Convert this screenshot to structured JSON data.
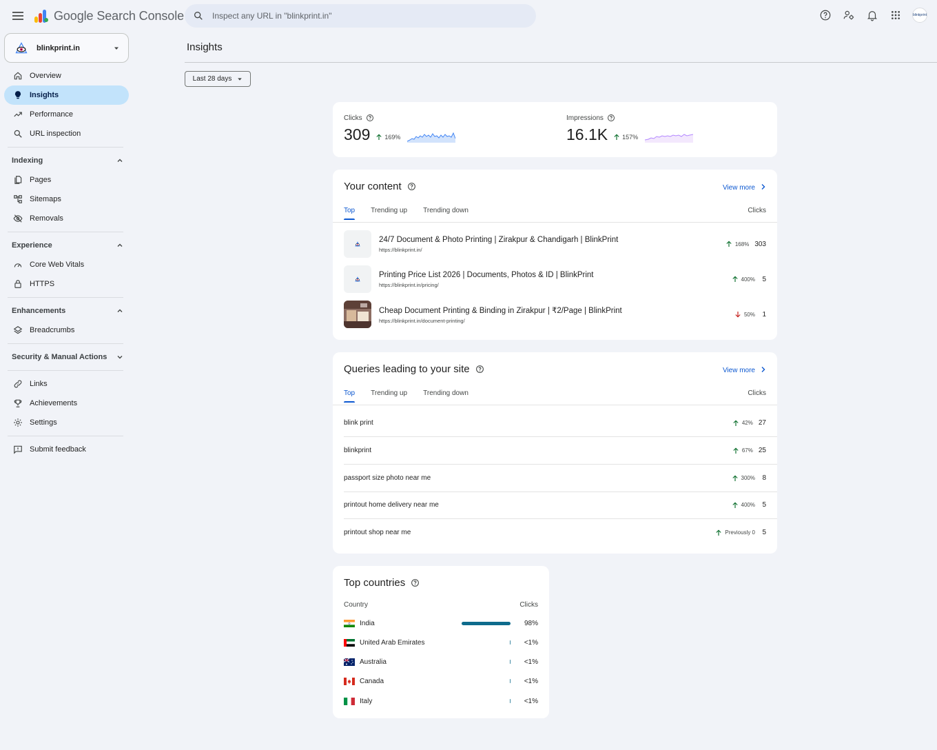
{
  "app": {
    "title": "Google Search Console",
    "search_placeholder": "Inspect any URL in \"blinkprint.in\"",
    "avatar_text": "blinkprint"
  },
  "property": {
    "name": "blinkprint.in"
  },
  "sidebar": {
    "top_items": [
      {
        "label": "Overview",
        "icon": "home-icon"
      },
      {
        "label": "Insights",
        "icon": "lightbulb-icon",
        "active": true
      },
      {
        "label": "Performance",
        "icon": "trending-icon"
      },
      {
        "label": "URL inspection",
        "icon": "search-icon"
      }
    ],
    "indexing": {
      "title": "Indexing",
      "items": [
        "Pages",
        "Sitemaps",
        "Removals"
      ]
    },
    "experience": {
      "title": "Experience",
      "items": [
        "Core Web Vitals",
        "HTTPS"
      ]
    },
    "enhancements": {
      "title": "Enhancements",
      "items": [
        "Breadcrumbs"
      ]
    },
    "security": {
      "title": "Security & Manual Actions"
    },
    "bottom_items": [
      "Links",
      "Achievements",
      "Settings"
    ],
    "feedback": "Submit feedback"
  },
  "main": {
    "title": "Insights",
    "date_range": "Last 28 days",
    "metrics": {
      "clicks": {
        "label": "Clicks",
        "value": "309",
        "change": "169%"
      },
      "impressions": {
        "label": "Impressions",
        "value": "16.1K",
        "change": "157%"
      }
    },
    "your_content": {
      "title": "Your content",
      "view_more": "View more",
      "tabs": [
        "Top",
        "Trending up",
        "Trending down"
      ],
      "column": "Clicks",
      "rows": [
        {
          "title": "24/7 Document & Photo Printing | Zirakpur & Chandigarh | BlinkPrint",
          "url": "https://blinkprint.in/",
          "change": "168%",
          "direction": "up",
          "count": "303"
        },
        {
          "title": "Printing Price List 2026 | Documents, Photos & ID | BlinkPrint",
          "url": "https://blinkprint.in/pricing/",
          "change": "400%",
          "direction": "up",
          "count": "5"
        },
        {
          "title": "Cheap Document Printing & Binding in Zirakpur | ₹2/Page | BlinkPrint",
          "url": "https://blinkprint.in/document-printing/",
          "change": "50%",
          "direction": "down",
          "count": "1"
        }
      ]
    },
    "queries": {
      "title": "Queries leading to your site",
      "view_more": "View more",
      "tabs": [
        "Top",
        "Trending up",
        "Trending down"
      ],
      "column": "Clicks",
      "rows": [
        {
          "query": "blink print",
          "change": "42%",
          "count": "27"
        },
        {
          "query": "blinkprint",
          "change": "67%",
          "count": "25"
        },
        {
          "query": "passport size photo near me",
          "change": "300%",
          "count": "8"
        },
        {
          "query": "printout home delivery near me",
          "change": "400%",
          "count": "5"
        },
        {
          "query": "printout shop near me",
          "change": "Previously 0",
          "count": "5"
        }
      ]
    },
    "countries": {
      "title": "Top countries",
      "col_country": "Country",
      "col_clicks": "Clicks",
      "rows": [
        {
          "name": "India",
          "pct": "98%",
          "share": 0.98
        },
        {
          "name": "United Arab Emirates",
          "pct": "<1%",
          "share": 0.005
        },
        {
          "name": "Australia",
          "pct": "<1%",
          "share": 0.005
        },
        {
          "name": "Canada",
          "pct": "<1%",
          "share": 0.005
        },
        {
          "name": "Italy",
          "pct": "<1%",
          "share": 0.005
        }
      ]
    }
  },
  "colors": {
    "accent": "#0b57d0",
    "active_nav": "#c2e3fb",
    "up_arrow": "#137333",
    "down_arrow": "#c5221f",
    "country_bar": "#0e6b8c",
    "clicks_spark": "#4285f4",
    "impressions_spark": "#b388ff"
  }
}
